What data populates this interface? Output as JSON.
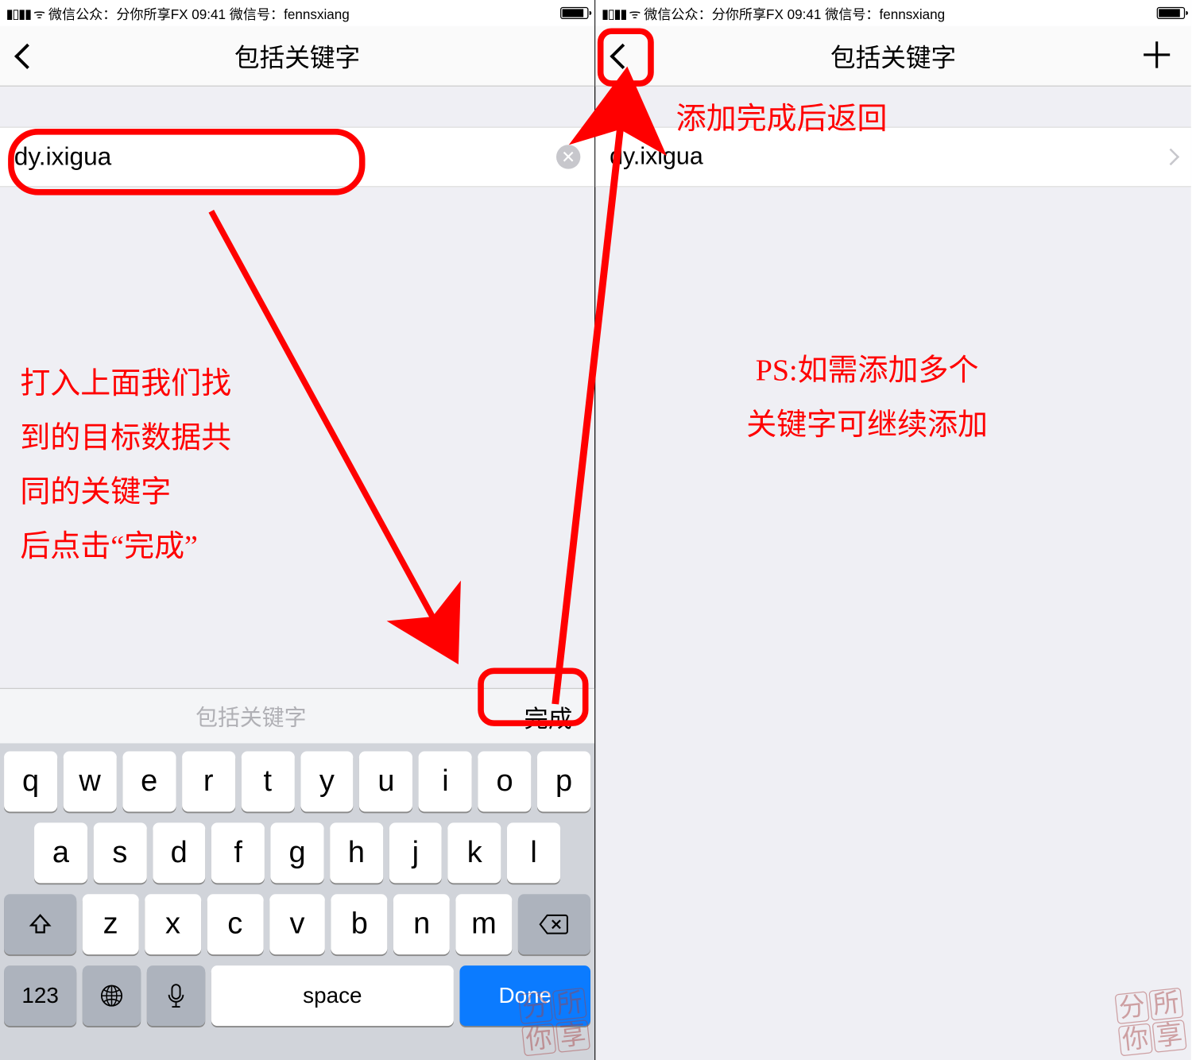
{
  "status": {
    "signal": "▮▮▮▮",
    "wifi": "✦",
    "text": "微信公众：分你所享FX  09:41  微信号：fennsxiang"
  },
  "nav": {
    "title": "包括关键字"
  },
  "left": {
    "input_value": "dy.ixigua",
    "kb_hint": "包括关键字",
    "kb_done": "完成"
  },
  "right": {
    "item": "dy.ixigua"
  },
  "keyboard": {
    "row1": [
      "q",
      "w",
      "e",
      "r",
      "t",
      "y",
      "u",
      "i",
      "o",
      "p"
    ],
    "row2": [
      "a",
      "s",
      "d",
      "f",
      "g",
      "h",
      "j",
      "k",
      "l"
    ],
    "row3": [
      "z",
      "x",
      "c",
      "v",
      "b",
      "n",
      "m"
    ],
    "num": "123",
    "space": "space",
    "enter": "Done"
  },
  "anno": {
    "left_block": "打入上面我们找\n到的目标数据共\n同的关键字\n后点击“完成”",
    "right_top": "添加完成后返回",
    "right_block": "PS:如需添加多个\n关键字可继续添加"
  }
}
